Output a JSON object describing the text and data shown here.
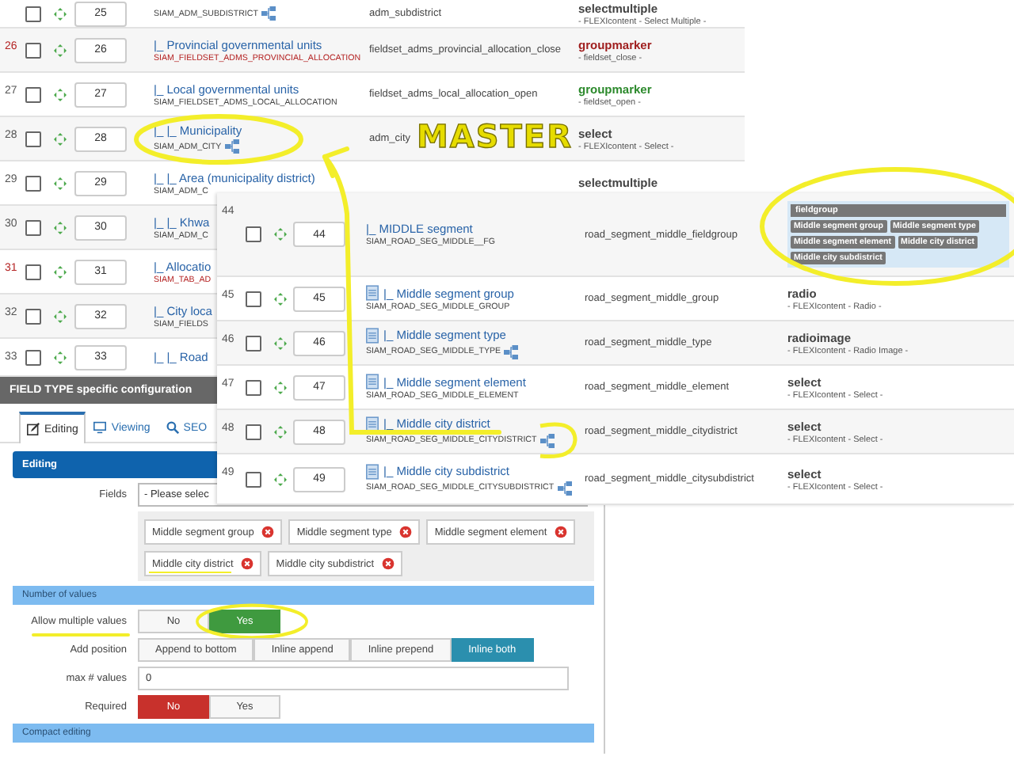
{
  "table": {
    "rows": [
      {
        "kind": "field",
        "checked": false,
        "order": "25",
        "code": "SIAM_ADM_SUBDISTRICT",
        "linked": true,
        "field": "adm_subdistrict",
        "type": "selectmultiple",
        "subtitle": "- FLEXIcontent - Select Multiple -"
      },
      {
        "kind": "group-close",
        "number": "26",
        "checked": false,
        "order": "26",
        "name": "|_ Provincial governmental units",
        "code": "SIAM_FIELDSET_ADMS_PROVINCIAL_ALLOCATION",
        "linked": false,
        "field": "fieldset_adms_provincial_allocation_close",
        "type": "groupmarker",
        "subtitle": "- fieldset_close -"
      },
      {
        "kind": "group-open",
        "number": "27",
        "checked": false,
        "order": "27",
        "name": "|_ Local governmental units",
        "code": "SIAM_FIELDSET_ADMS_LOCAL_ALLOCATION",
        "linked": false,
        "field": "fieldset_adms_local_allocation_open",
        "type": "groupmarker",
        "subtitle": "- fieldset_open -"
      },
      {
        "kind": "field",
        "number": "28",
        "checked": false,
        "order": "28",
        "name": "|_ |_ Municipality",
        "code": "SIAM_ADM_CITY",
        "linked": true,
        "field": "adm_city",
        "type": "select",
        "subtitle": "- FLEXIcontent - Select -"
      },
      {
        "kind": "field",
        "number": "29",
        "checked": false,
        "order": "29",
        "name": "|_ |_ Area (municipality district)",
        "code": "SIAM_ADM_C",
        "linked": false,
        "type": "selectmultiple"
      },
      {
        "kind": "field",
        "number": "30",
        "checked": false,
        "order": "30",
        "name": "|_ |_ Khwa",
        "code": "SIAM_ADM_C",
        "linked": false
      },
      {
        "kind": "tab",
        "number": "31",
        "checked": false,
        "order": "31",
        "name": "|_ Allocatio",
        "code": "SIAM_TAB_AD",
        "linked": false
      },
      {
        "kind": "field",
        "number": "32",
        "checked": false,
        "order": "32",
        "name": "|_ City loca",
        "code": "SIAM_FIELDS",
        "linked": false
      },
      {
        "kind": "field",
        "number": "33",
        "checked": false,
        "order": "33",
        "name": "|_ |_ Road",
        "linked": false
      }
    ]
  },
  "overlay_table": {
    "rows": [
      {
        "kind": "fieldgroup",
        "number": "44",
        "checked": false,
        "order": "44",
        "name": "|_ MIDDLE segment",
        "code": "SIAM_ROAD_SEG_MIDDLE__FG",
        "linked": false,
        "field": "road_segment_middle_fieldgroup",
        "group_title": "fieldgroup",
        "group_members": [
          "Middle segment group",
          "Middle segment type",
          "Middle segment element",
          "Middle city district",
          "Middle city subdistrict"
        ]
      },
      {
        "kind": "field",
        "number": "45",
        "checked": false,
        "order": "45",
        "name": "|_ Middle segment group",
        "code": "SIAM_ROAD_SEG_MIDDLE_GROUP",
        "linked": false,
        "field": "road_segment_middle_group",
        "type": "radio",
        "subtitle": "- FLEXIcontent - Radio -"
      },
      {
        "kind": "field",
        "number": "46",
        "checked": false,
        "order": "46",
        "name": "|_ Middle segment type",
        "code": "SIAM_ROAD_SEG_MIDDLE_TYPE",
        "linked": true,
        "field": "road_segment_middle_type",
        "type": "radioimage",
        "subtitle": "- FLEXIcontent - Radio Image -"
      },
      {
        "kind": "field",
        "number": "47",
        "checked": false,
        "order": "47",
        "name": "|_ Middle segment element",
        "code": "SIAM_ROAD_SEG_MIDDLE_ELEMENT",
        "linked": false,
        "field": "road_segment_middle_element",
        "type": "select",
        "subtitle": "- FLEXIcontent - Select -"
      },
      {
        "kind": "field",
        "number": "48",
        "checked": false,
        "order": "48",
        "name": "|_ Middle city district",
        "code": "SIAM_ROAD_SEG_MIDDLE_CITYDISTRICT",
        "linked": true,
        "field": "road_segment_middle_citydistrict",
        "type": "select",
        "subtitle": "- FLEXIcontent - Select -"
      },
      {
        "kind": "field",
        "number": "49",
        "checked": false,
        "order": "49",
        "name": "|_ Middle city subdistrict",
        "code": "SIAM_ROAD_SEG_MIDDLE_CITYSUBDISTRICT",
        "linked": true,
        "field": "road_segment_middle_citysubdistrict",
        "type": "select",
        "subtitle": "- FLEXIcontent - Select -"
      }
    ]
  },
  "annotation": {
    "text": "MASTER"
  },
  "config": {
    "title": "FIELD TYPE specific configuration",
    "tabs": [
      {
        "label": "Editing",
        "selected": true
      },
      {
        "label": "Viewing",
        "selected": false
      },
      {
        "label": "SEO",
        "selected": false
      }
    ],
    "section": "Editing",
    "fields_label": "Fields",
    "fields_placeholder": "- Please selec",
    "chosen": [
      "Middle segment group",
      "Middle segment type",
      "Middle segment element",
      "Middle city district",
      "Middle city subdistrict"
    ],
    "values_section": "Number of values",
    "rows": [
      {
        "kind": "buttons",
        "label": "Allow multiple values",
        "color": "#3f9a3f",
        "options": [
          {
            "label": "No",
            "selected": false
          },
          {
            "label": "Yes",
            "selected": true
          }
        ]
      },
      {
        "kind": "buttons",
        "label": "Add position",
        "color": "#2b8fae",
        "options": [
          {
            "label": "Append to bottom",
            "selected": false
          },
          {
            "label": "Inline append",
            "selected": false
          },
          {
            "label": "Inline prepend",
            "selected": false
          },
          {
            "label": "Inline both",
            "selected": true
          }
        ]
      },
      {
        "kind": "input",
        "label": "max # values",
        "value": "0"
      },
      {
        "kind": "buttons",
        "label": "Required",
        "color": "#c8312c",
        "options": [
          {
            "label": "No",
            "selected": true
          },
          {
            "label": "Yes",
            "selected": false
          }
        ]
      }
    ],
    "next_section": "Compact editing"
  }
}
